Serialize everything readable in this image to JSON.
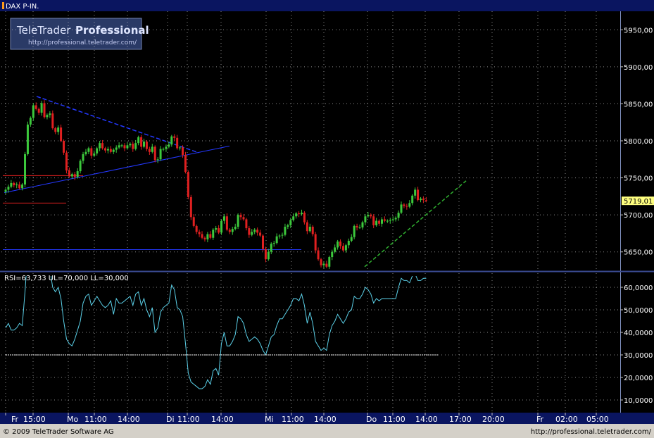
{
  "header": {
    "symbol": "DAX P-IN."
  },
  "watermark": {
    "brand": "TeleTrader",
    "brand_bold": "Professional",
    "url": "http://professional.teletrader.com/"
  },
  "footer": {
    "copyright": "© 2009 TeleTrader Software AG",
    "url": "http://professional.teletrader.com/"
  },
  "colors": {
    "background": "#000000",
    "frame": "#0a1560",
    "up": "#3cc83c",
    "down": "#e02020",
    "grid": "#c8c8c8",
    "rsi_line": "#5bd0e8",
    "trend_blue": "#2438ff",
    "trend_green": "#30b030",
    "last_price_bg": "#ffff80"
  },
  "chart_data": [
    {
      "type": "candlestick",
      "title": "DAX P-IN.",
      "ylim": [
        5625,
        5975
      ],
      "y_ticks": [
        5650,
        5700,
        5750,
        5800,
        5850,
        5900,
        5950
      ],
      "y_tick_labels": [
        "5650,00",
        "5700,00",
        "5750,00",
        "5800,00",
        "5850,00",
        "5900,00",
        "5950,00"
      ],
      "last_price": 5719.01,
      "last_price_label": "5719,01",
      "x_tick_labels": [
        "Fr",
        "15:00",
        "Mo",
        "11:00",
        "14:00",
        "Di",
        "11:00",
        "14:00",
        "Mi",
        "11:00",
        "14:00",
        "Do",
        "11:00",
        "14:00",
        "17:00",
        "20:00",
        "Fr",
        "02:00",
        "05:00"
      ],
      "bar_count": 157,
      "closes": [
        5734,
        5738,
        5743,
        5740,
        5741,
        5736,
        5741,
        5782,
        5822,
        5831,
        5848,
        5843,
        5838,
        5851,
        5832,
        5835,
        5837,
        5817,
        5812,
        5818,
        5800,
        5784,
        5760,
        5752,
        5755,
        5751,
        5759,
        5773,
        5782,
        5785,
        5790,
        5780,
        5783,
        5790,
        5797,
        5790,
        5787,
        5789,
        5785,
        5788,
        5791,
        5794,
        5794,
        5790,
        5794,
        5796,
        5789,
        5797,
        5805,
        5792,
        5799,
        5789,
        5785,
        5792,
        5774,
        5775,
        5789,
        5789,
        5792,
        5795,
        5806,
        5804,
        5790,
        5791,
        5781,
        5758,
        5724,
        5697,
        5685,
        5677,
        5674,
        5669,
        5667,
        5674,
        5669,
        5680,
        5682,
        5676,
        5692,
        5698,
        5680,
        5677,
        5681,
        5684,
        5700,
        5697,
        5694,
        5682,
        5673,
        5677,
        5680,
        5676,
        5672,
        5654,
        5640,
        5650,
        5661,
        5662,
        5671,
        5672,
        5673,
        5684,
        5686,
        5693,
        5698,
        5702,
        5701,
        5703,
        5690,
        5678,
        5684,
        5674,
        5652,
        5640,
        5632,
        5634,
        5630,
        5643,
        5650,
        5656,
        5664,
        5658,
        5652,
        5659,
        5665,
        5670,
        5685,
        5683,
        5683,
        5690,
        5698,
        5700,
        5698,
        5686,
        5692,
        5688,
        5694,
        5692,
        5692,
        5693,
        5694,
        5696,
        5703,
        5714,
        5712,
        5711,
        5716,
        5726,
        5734,
        5720,
        5722,
        5720,
        5719
      ]
    },
    {
      "type": "line",
      "title": "RSI",
      "legend": "RSI=63,733 UL=70,000 LL=30,000",
      "rsi_value": 63.733,
      "upper_limit": 70,
      "lower_limit": 30,
      "ylim": [
        5,
        65
      ],
      "y_ticks": [
        10,
        20,
        30,
        40,
        50,
        60
      ],
      "y_tick_labels": [
        "10,0000",
        "20,0000",
        "30,0000",
        "40,0000",
        "50,0000",
        "60,0000"
      ],
      "values": [
        42,
        44,
        41,
        41,
        42,
        44,
        43,
        58,
        75,
        75,
        68,
        74,
        72,
        69,
        71,
        67,
        68,
        60,
        58,
        60,
        55,
        45,
        37,
        35,
        34,
        37,
        41,
        45,
        53,
        56,
        57,
        52,
        54,
        56,
        54,
        52,
        51,
        52,
        54,
        48,
        55,
        53,
        53,
        54,
        55,
        56,
        52,
        57,
        58,
        52,
        55,
        50,
        47,
        51,
        40,
        42,
        49,
        51,
        52,
        53,
        61,
        59,
        51,
        50,
        47,
        35,
        22,
        18,
        17,
        16,
        15,
        15,
        16,
        19,
        17,
        23,
        24,
        21,
        35,
        40,
        34,
        34,
        36,
        39,
        47,
        46,
        44,
        39,
        36,
        37,
        38,
        37,
        35,
        32,
        30,
        34,
        38,
        39,
        43,
        46,
        46,
        48,
        50,
        52,
        55,
        55,
        54,
        57,
        52,
        44,
        49,
        44,
        36,
        34,
        32,
        33,
        32,
        39,
        43,
        45,
        48,
        46,
        44,
        46,
        49,
        50,
        56,
        55,
        55,
        57,
        60,
        59,
        57,
        53,
        55,
        54,
        55,
        55,
        55,
        55,
        55,
        55,
        60,
        64,
        63,
        63,
        62,
        65,
        66,
        63,
        63,
        64,
        64
      ]
    }
  ]
}
